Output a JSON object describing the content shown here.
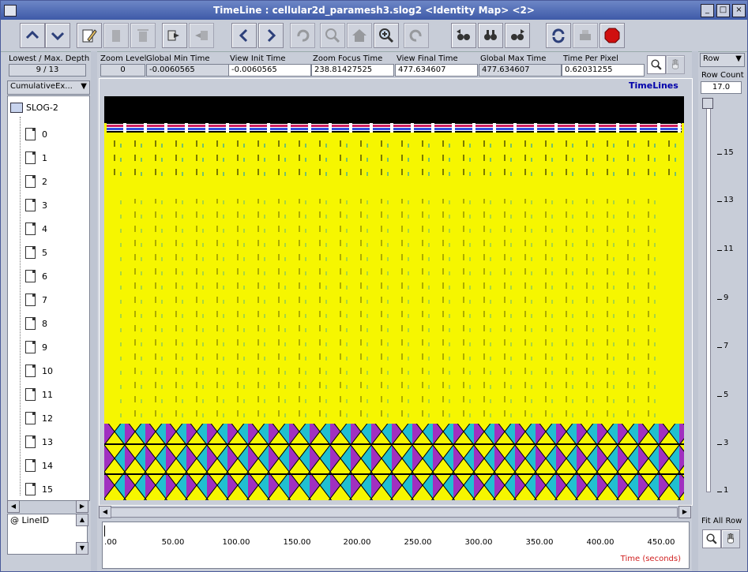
{
  "window": {
    "title": "TimeLine : cellular2d_paramesh3.slog2  <Identity Map> <2>",
    "controls": [
      "_",
      "□",
      "×"
    ]
  },
  "toolbar": {
    "buttons": [
      "up-icon",
      "down-icon",
      "edit-icon",
      "paste-icon",
      "delete-icon",
      "next-icon",
      "prev-icon",
      "left-icon",
      "right-icon",
      "undo-icon",
      "zoom-out-icon",
      "home-icon",
      "zoom-in-icon",
      "redo-icon",
      "search-back-icon",
      "search-icon",
      "search-forward-icon",
      "refresh-icon",
      "print-icon",
      "stop-icon"
    ]
  },
  "info": {
    "depth_label": "Lowest / Max. Depth",
    "depth_value": "9 / 13",
    "zoom_level_label": "Zoom Level",
    "zoom_level_value": "0",
    "global_min_label": "Global Min Time",
    "global_min_value": "-0.0060565",
    "view_init_label": "View  Init Time",
    "view_init_value": "-0.0060565",
    "zoom_focus_label": "Zoom Focus Time",
    "zoom_focus_value": "238.81427525",
    "view_final_label": "View Final Time",
    "view_final_value": "477.634607",
    "global_max_label": "Global Max Time",
    "global_max_value": "477.634607",
    "time_per_pixel_label": "Time Per Pixel",
    "time_per_pixel_value": "0.62031255"
  },
  "left": {
    "dropdown": "CumulativeEx...",
    "root": "SLOG-2",
    "items": [
      "0",
      "1",
      "2",
      "3",
      "4",
      "5",
      "6",
      "7",
      "8",
      "9",
      "10",
      "11",
      "12",
      "13",
      "14",
      "15"
    ],
    "legend": "@ LineID"
  },
  "canvas": {
    "title": "TimeLines"
  },
  "right": {
    "row_dropdown": "Row",
    "row_count_label": "Row Count",
    "row_count_value": "17.0",
    "y_labels": [
      "15",
      "13",
      "11",
      "9",
      "7",
      "5",
      "3",
      "1"
    ],
    "fit_label": "Fit All Row"
  },
  "axis": {
    "ticks": [
      ".00",
      "50.00",
      "100.00",
      "150.00",
      "200.00",
      "250.00",
      "300.00",
      "350.00",
      "400.00",
      "450.00"
    ],
    "label": "Time (seconds)"
  }
}
